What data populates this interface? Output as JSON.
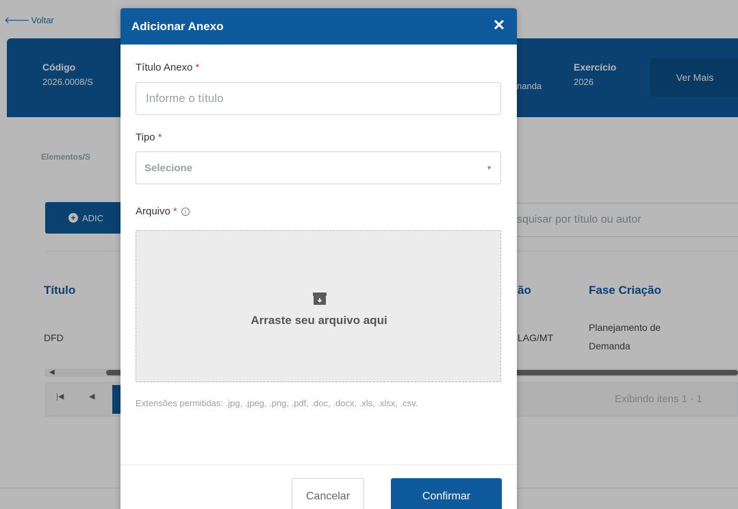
{
  "background": {
    "back_link": "Voltar",
    "header": {
      "codigo_label": "Código",
      "codigo_value": "2026.0008/S",
      "partial_value": "nanda",
      "exercicio_label": "Exercício",
      "exercicio_value": "2026",
      "ver_mais": "Ver Mais"
    },
    "section_label": "Elementos/S",
    "add_button": "ADIC",
    "search_placeholder": "squisar por título ou autor",
    "table": {
      "headers": [
        "Título",
        "ão",
        "Fase Criação"
      ],
      "row": {
        "titulo": "DFD",
        "orgao": "LAG/MT",
        "fase_line1": "Planejamento de",
        "fase_line2": "Demanda"
      }
    },
    "pager_info": "Exibindo itens 1 - 1"
  },
  "modal": {
    "title": "Adicionar Anexo",
    "close_icon": "close-icon",
    "titulo_label": "Título Anexo",
    "titulo_placeholder": "Informe o título",
    "tipo_label": "Tipo",
    "tipo_placeholder": "Selecione",
    "arquivo_label": "Arquivo",
    "required_mark": "*",
    "info_icon": "info-icon",
    "dropzone_text": "Arraste seu arquivo aqui",
    "dropzone_icon": "archive-icon",
    "extensions_note": "Extensões permitidas: .jpg, .jpeg, .png, .pdf, .doc, .docx, .xls, .xlsx, .csv.",
    "cancel": "Cancelar",
    "confirm": "Confirmar"
  },
  "colors": {
    "primary": "#0e5a9c",
    "required": "#d9363e"
  }
}
